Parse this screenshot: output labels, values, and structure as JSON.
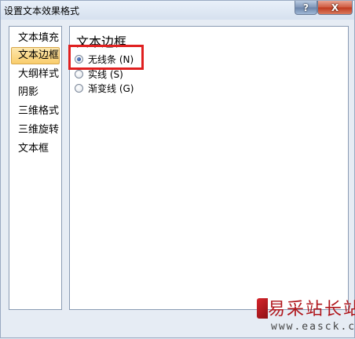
{
  "window": {
    "title": "设置文本效果格式",
    "help_label": "?",
    "close_label": "X"
  },
  "nav": {
    "items": [
      {
        "label": "文本填充",
        "selected": false
      },
      {
        "label": "文本边框",
        "selected": true
      },
      {
        "label": "大纲样式",
        "selected": false
      },
      {
        "label": "阴影",
        "selected": false
      },
      {
        "label": "三维格式",
        "selected": false
      },
      {
        "label": "三维旋转",
        "selected": false
      },
      {
        "label": "文本框",
        "selected": false
      }
    ]
  },
  "panel": {
    "title": "文本边框",
    "options": [
      {
        "label": "无线条 (N)",
        "checked": true
      },
      {
        "label": "实线 (S)",
        "checked": false
      },
      {
        "label": "渐变线 (G)",
        "checked": false
      }
    ]
  },
  "colors": {
    "highlight": "#e02020",
    "selected_nav": "#f9cd6c"
  },
  "watermark": {
    "name": "易采站长站",
    "url": "www.easck.com"
  }
}
